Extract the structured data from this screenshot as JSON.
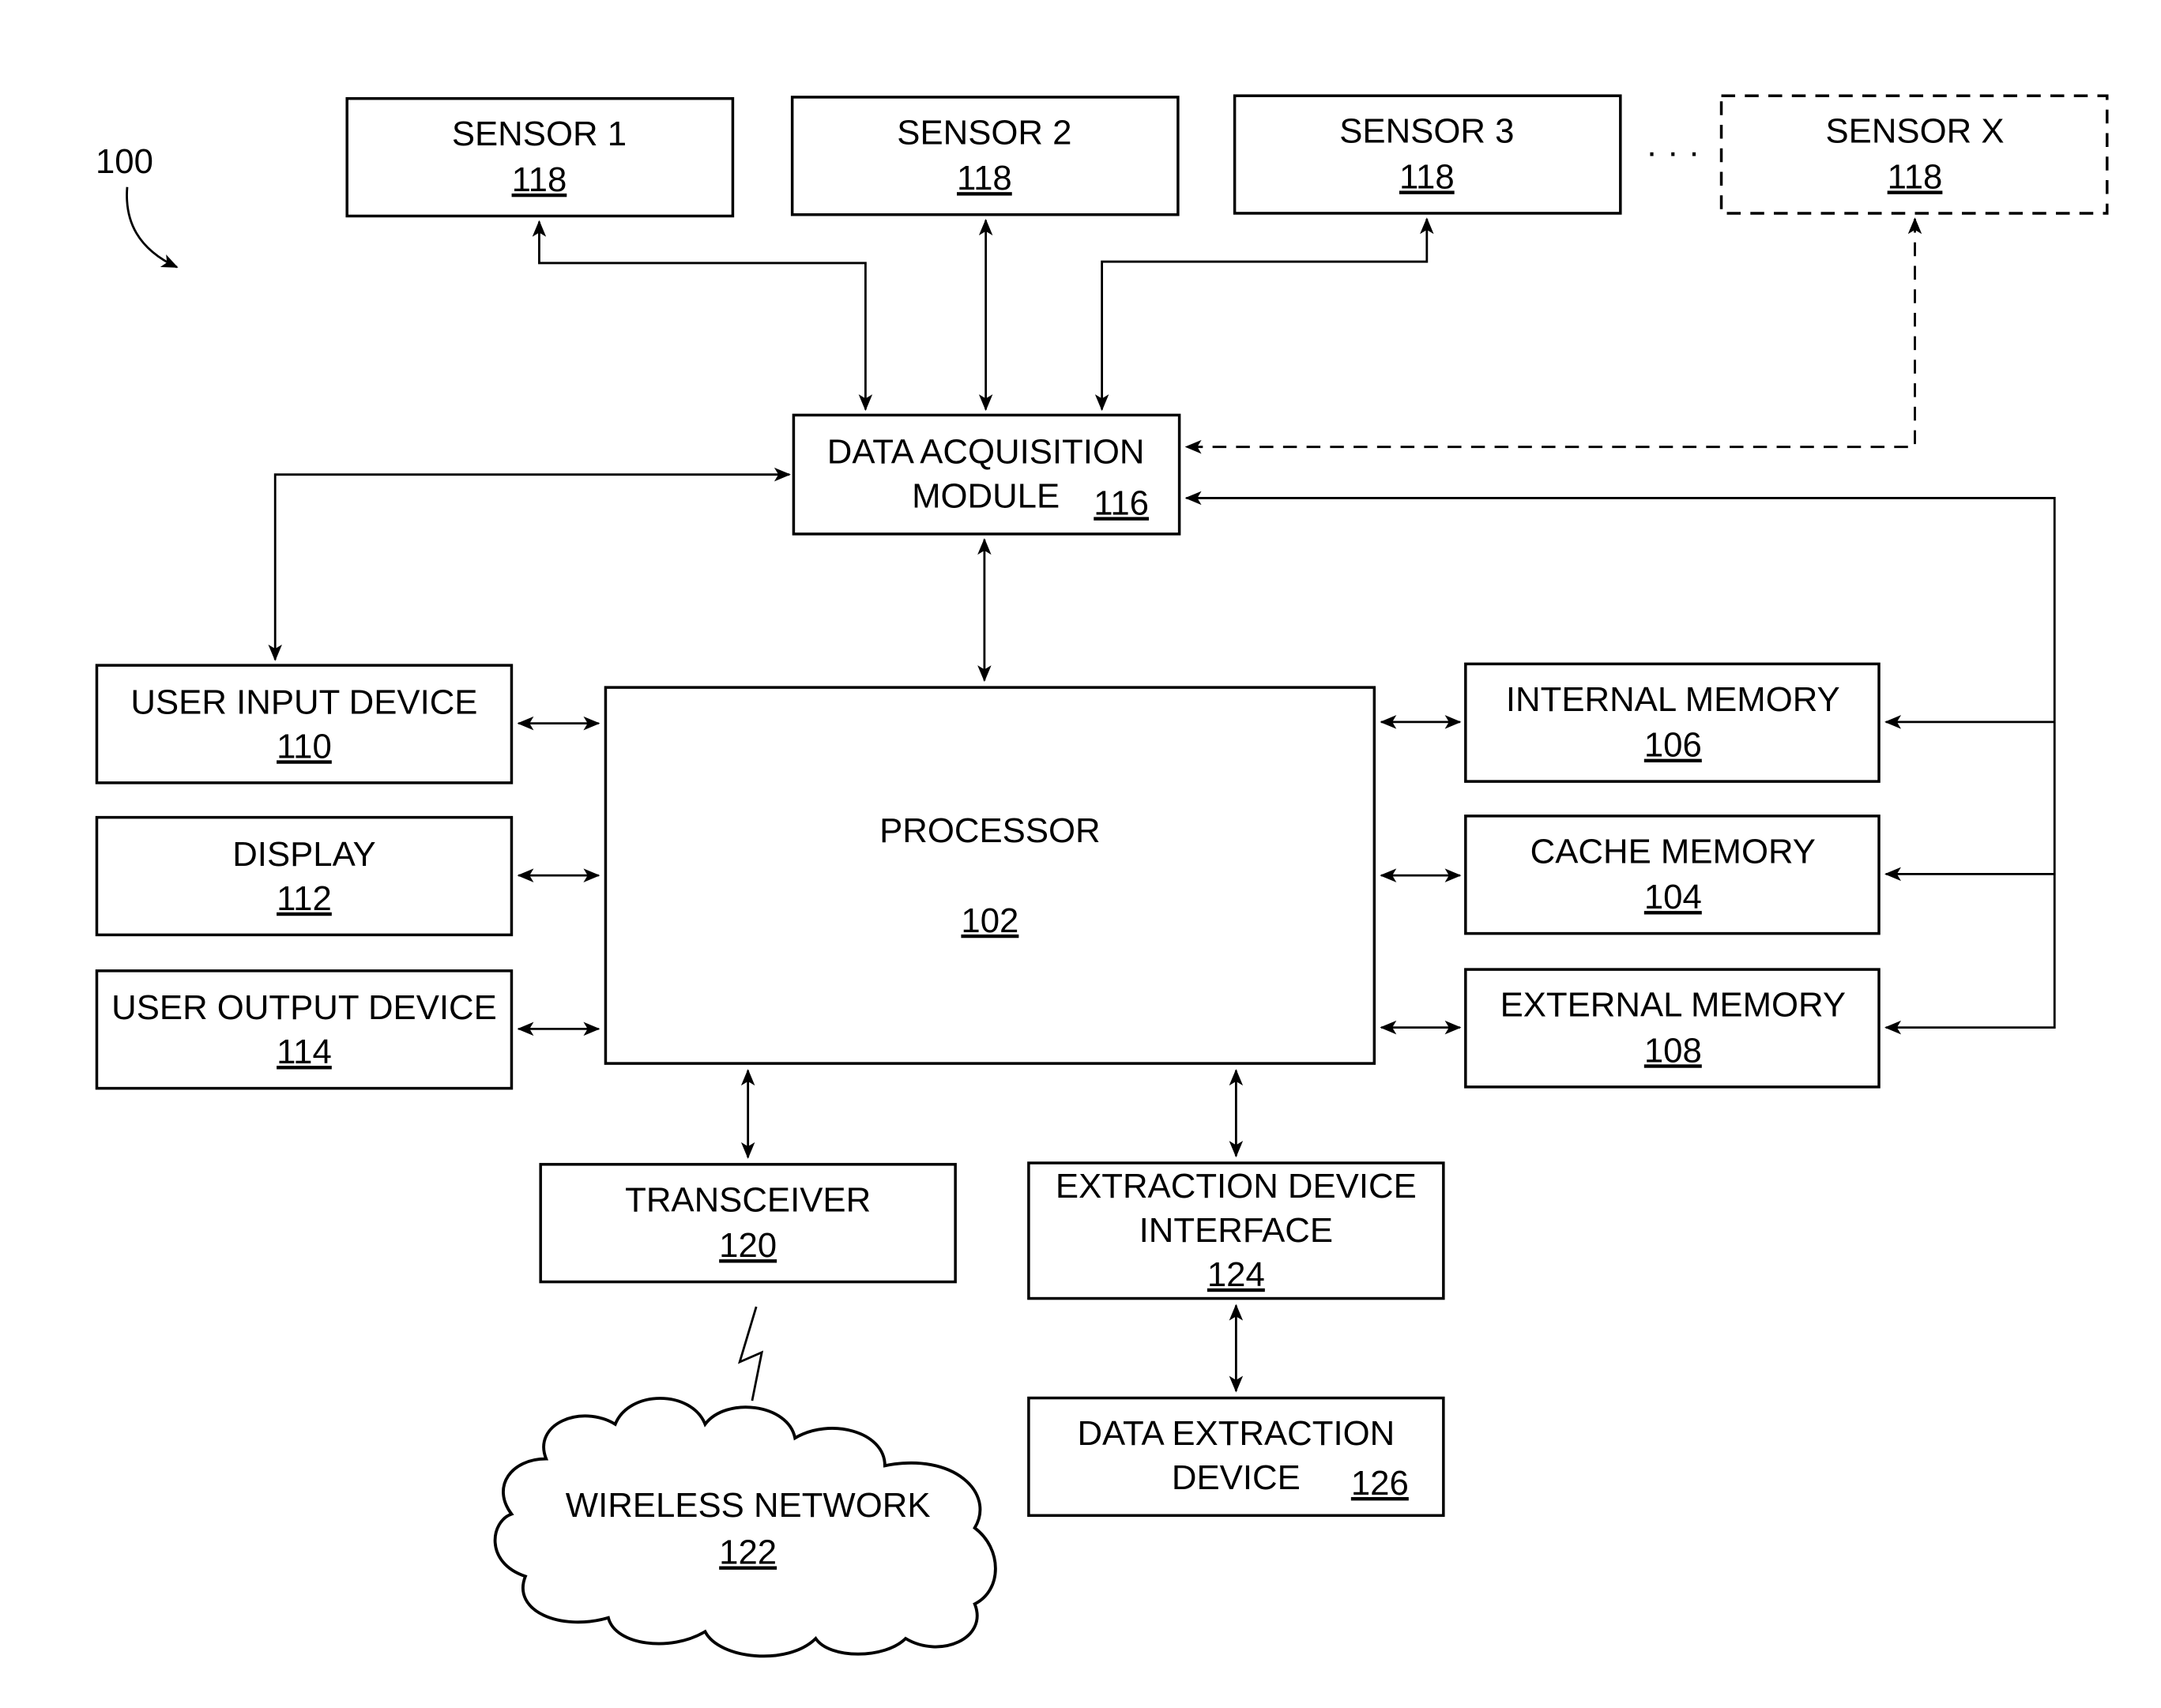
{
  "figure": {
    "reference_label": "100",
    "ellipsis": "· · ·"
  },
  "sensors": [
    {
      "name": "SENSOR 1",
      "ref": "118"
    },
    {
      "name": "SENSOR 2",
      "ref": "118"
    },
    {
      "name": "SENSOR 3",
      "ref": "118"
    },
    {
      "name": "SENSOR X",
      "ref": "118",
      "optional": true
    }
  ],
  "data_acquisition": {
    "line1": "DATA ACQUISITION",
    "line2": "MODULE",
    "ref": "116"
  },
  "processor": {
    "name": "PROCESSOR",
    "ref": "102"
  },
  "left_blocks": [
    {
      "name": "USER INPUT DEVICE",
      "ref": "110"
    },
    {
      "name": "DISPLAY",
      "ref": "112"
    },
    {
      "name": "USER OUTPUT DEVICE",
      "ref": "114"
    }
  ],
  "right_blocks": [
    {
      "name": "INTERNAL MEMORY",
      "ref": "106"
    },
    {
      "name": "CACHE MEMORY",
      "ref": "104"
    },
    {
      "name": "EXTERNAL MEMORY",
      "ref": "108"
    }
  ],
  "transceiver": {
    "name": "TRANSCEIVER",
    "ref": "120"
  },
  "wireless_network": {
    "name": "WIRELESS NETWORK",
    "ref": "122"
  },
  "extraction_interface": {
    "line1": "EXTRACTION DEVICE",
    "line2": "INTERFACE",
    "ref": "124"
  },
  "data_extraction_device": {
    "line1": "DATA EXTRACTION",
    "line2": "DEVICE",
    "ref": "126"
  }
}
